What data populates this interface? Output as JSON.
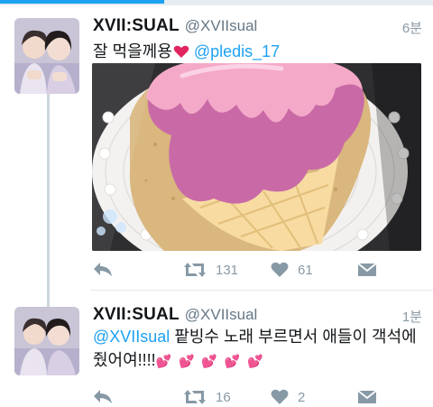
{
  "progress": {
    "fraction": 0.38,
    "color": "#1da1f2"
  },
  "tweets": [
    {
      "display_name": "XVII:SUAL",
      "handle": "@XVIIsual",
      "time": "6분",
      "text": "잘 먹을께용",
      "emoji": "heart",
      "mention": "@pledis_17",
      "replies": "",
      "retweets": "131",
      "likes": "61"
    },
    {
      "display_name": "XVII:SUAL",
      "handle": "@XVIIsual",
      "time": "1분",
      "mention": "@XVIIsual",
      "text_line1": " 팥빙수 노래 부르면서 애들이 객석에",
      "text_line2": "줬어여!!!!",
      "hearts": "💕 💕 💕 💕 💕",
      "replies": "",
      "retweets": "16",
      "likes": "2"
    }
  ],
  "colors": {
    "accent": "#1da1f2",
    "heart": "#e0245e",
    "muted": "#8899a6"
  },
  "icons": [
    "reply-icon",
    "retweet-icon",
    "like-icon",
    "dm-icon"
  ]
}
